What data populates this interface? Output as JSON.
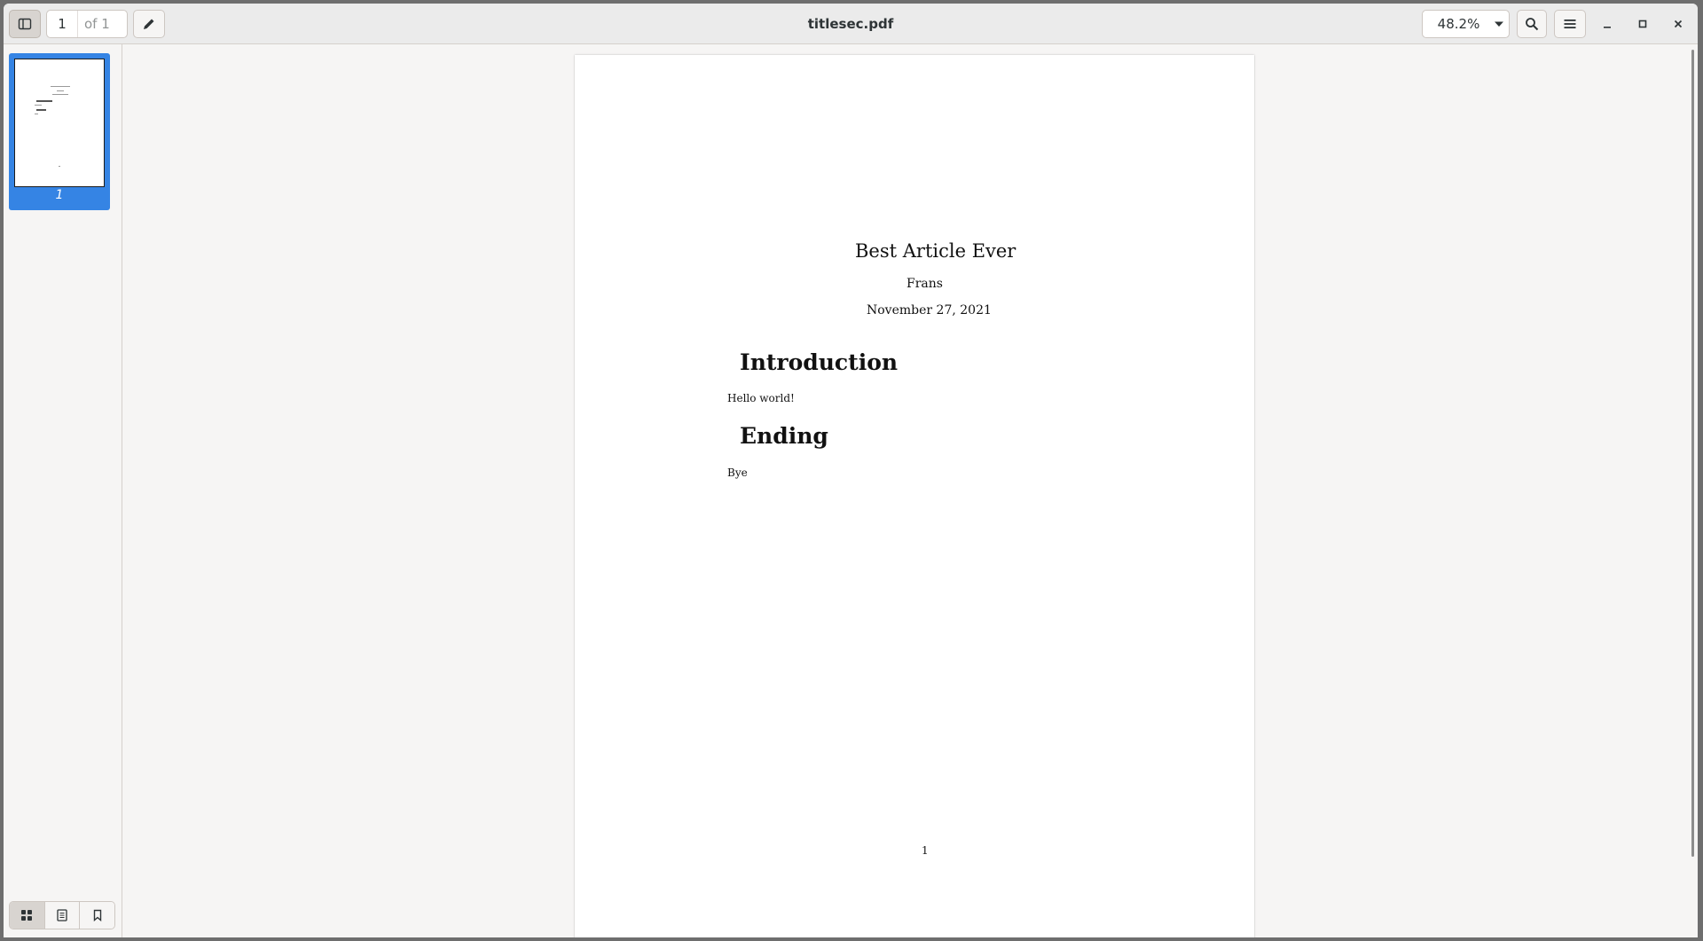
{
  "window": {
    "title": "titlesec.pdf"
  },
  "toolbar": {
    "page_number": "1",
    "page_total": "of 1",
    "zoom": "48.2%"
  },
  "sidebar": {
    "thumbnails": [
      {
        "label": "1"
      }
    ]
  },
  "document": {
    "title": "Best Article Ever",
    "author": "Frans",
    "date": "November 27, 2021",
    "sections": [
      {
        "heading": "Introduction",
        "body": "Hello world!"
      },
      {
        "heading": "Ending",
        "body": "Bye"
      }
    ],
    "page_footer": "1"
  },
  "colors": {
    "accent": "#3584e4",
    "headerbar": "#ebebeb",
    "background": "#f6f5f4"
  },
  "icons": {
    "sidebar_toggle": "sidebar-show-icon",
    "annotate": "pencil-icon",
    "zoom_dropdown": "pan-down-icon",
    "search": "search-icon",
    "menu": "hamburger-menu-icon",
    "minimize": "minimize-icon",
    "maximize": "maximize-icon",
    "close": "close-icon",
    "thumbnails_view": "grid-icon",
    "outline_view": "document-icon",
    "bookmarks_view": "bookmark-icon"
  }
}
